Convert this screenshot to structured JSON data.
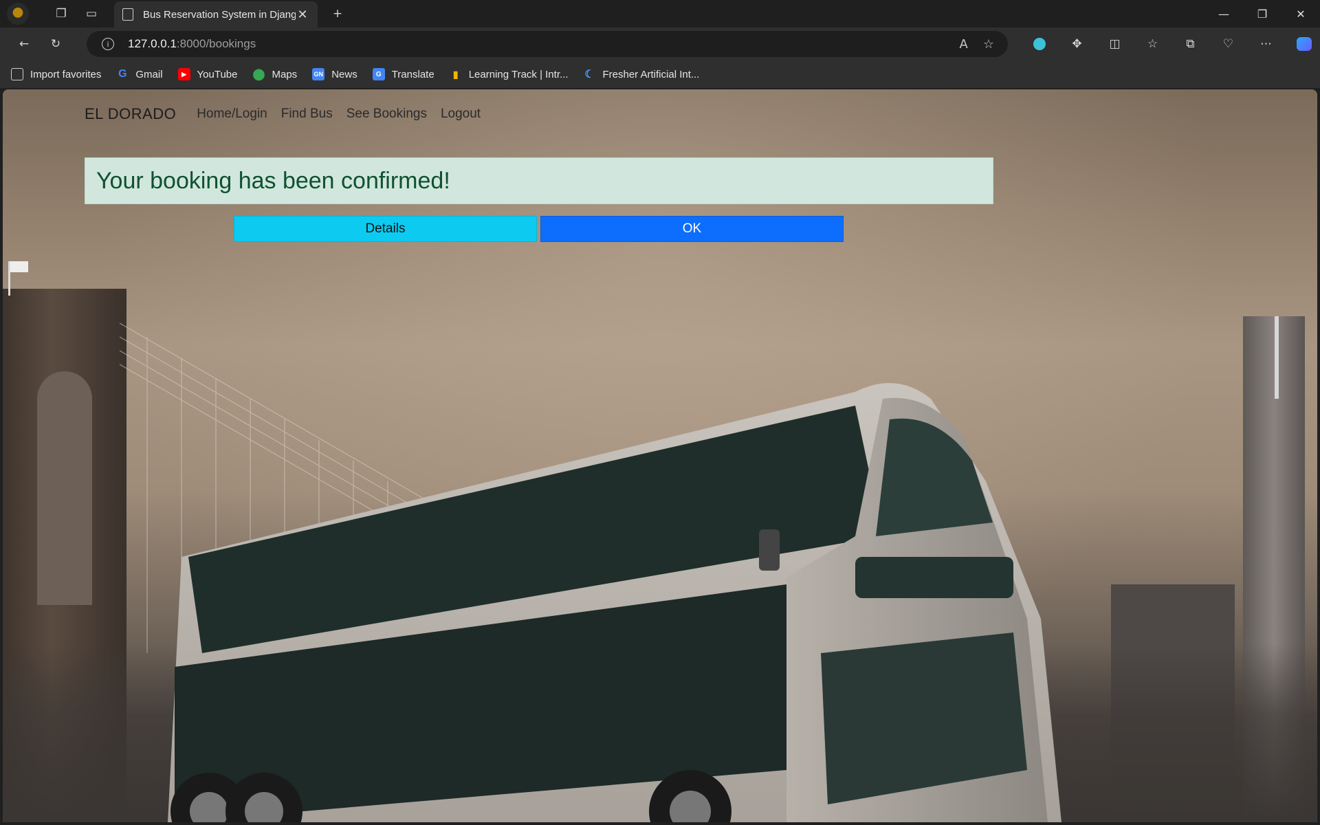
{
  "browser": {
    "tab_title": "Bus Reservation System in Djang",
    "url_host": "127.0.0.1",
    "url_path": ":8000/bookings",
    "favorites": [
      {
        "label": "Import favorites",
        "icon": "import-icon"
      },
      {
        "label": "Gmail",
        "icon": "google-icon"
      },
      {
        "label": "YouTube",
        "icon": "youtube-icon"
      },
      {
        "label": "Maps",
        "icon": "maps-pin-icon"
      },
      {
        "label": "News",
        "icon": "news-icon"
      },
      {
        "label": "Translate",
        "icon": "translate-icon"
      },
      {
        "label": "Learning Track | Intr...",
        "icon": "chart-bars-icon"
      },
      {
        "label": "Fresher Artificial Int...",
        "icon": "crescent-icon"
      }
    ]
  },
  "site": {
    "brand": "EL DORADO",
    "nav": [
      "Home/Login",
      "Find Bus",
      "See Bookings",
      "Logout"
    ],
    "alert": "Your booking has been confirmed!",
    "details_label": "Details",
    "ok_label": "OK"
  },
  "colors": {
    "alert_bg": "#d1e7dd",
    "alert_text": "#0f5132",
    "details_btn": "#0dcaf0",
    "ok_btn": "#0d6efd"
  }
}
